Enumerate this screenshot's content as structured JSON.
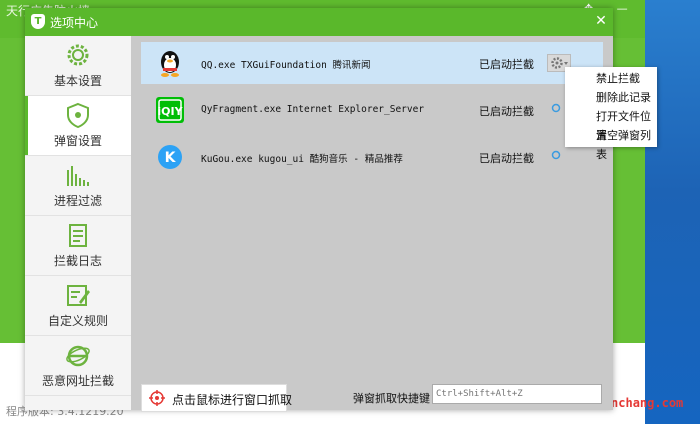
{
  "background_app": {
    "title": "天行广告防火墙",
    "window_controls": "▁ ✥ — ✕",
    "version_text": "程序版本: 3.4.1219.20"
  },
  "watermark": "www.qinpinchang.com",
  "dialog": {
    "title": "选项中心",
    "close_label": "✕",
    "accent_color": "#5ab82b"
  },
  "nav": {
    "items": [
      {
        "label": "基本设置",
        "icon": "gear-icon",
        "active": false
      },
      {
        "label": "弹窗设置",
        "icon": "shield-icon",
        "active": true
      },
      {
        "label": "进程过滤",
        "icon": "bar-filter-icon",
        "active": false
      },
      {
        "label": "拦截日志",
        "icon": "log-clipboard-icon",
        "active": false
      },
      {
        "label": "自定义规则",
        "icon": "rule-edit-icon",
        "active": false
      },
      {
        "label": "恶意网址拦截",
        "icon": "ie-globe-icon",
        "active": false
      }
    ]
  },
  "rules": [
    {
      "text": "QQ.exe TXGuiFoundation 腾讯新闻",
      "status": "已启动拦截",
      "icon": "qq-penguin-icon"
    },
    {
      "text": "QyFragment.exe Internet Explorer_Server",
      "status": "已启动拦截",
      "icon": "iqiyi-icon"
    },
    {
      "text": "KuGou.exe kugou_ui 酷狗音乐 - 精品推荐",
      "status": "已启动拦截",
      "icon": "kugou-icon"
    }
  ],
  "context_menu": {
    "items": [
      "禁止拦截",
      "删除此记录",
      "打开文件位置",
      "清空弹窗列表"
    ]
  },
  "bottom": {
    "capture_label": "点击鼠标进行窗口抓取",
    "hotkey_label": "弹窗抓取快捷键",
    "hotkey_placeholder": "Ctrl+Shift+Alt+Z"
  }
}
